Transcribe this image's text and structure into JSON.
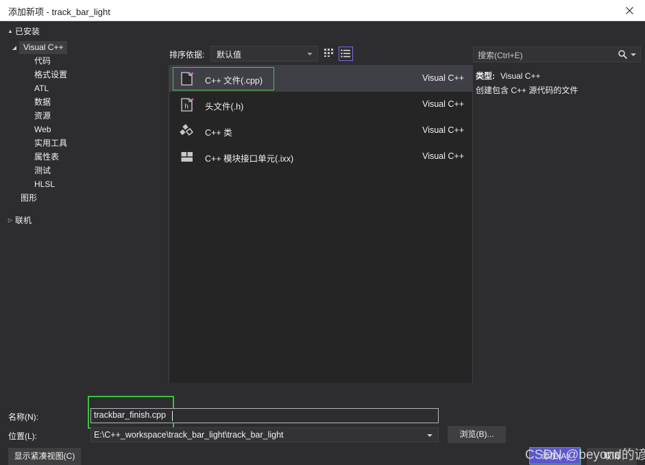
{
  "window": {
    "title": "添加新项 - track_bar_light",
    "close_icon": "close-icon"
  },
  "sidebar": {
    "installed_label": "已安装",
    "installed_twisty": "▲",
    "root_label": "Visual C++",
    "root_twisty": "◢",
    "children": [
      {
        "label": "代码"
      },
      {
        "label": "格式设置"
      },
      {
        "label": "ATL"
      },
      {
        "label": "数据"
      },
      {
        "label": "资源"
      },
      {
        "label": "Web"
      },
      {
        "label": "实用工具"
      },
      {
        "label": "属性表"
      },
      {
        "label": "测试"
      },
      {
        "label": "HLSL"
      }
    ],
    "graphics_label": "图形",
    "online_label": "联机",
    "online_twisty": "▷"
  },
  "toolbar": {
    "sort_label": "排序依据:",
    "sort_value": "默认值",
    "grid_view_icon": "grid-view-icon",
    "list_view_icon": "list-view-icon"
  },
  "search": {
    "placeholder": "搜索(Ctrl+E)",
    "icon": "search-icon"
  },
  "templates": {
    "items": [
      {
        "title": "C++ 文件(.cpp)",
        "origin": "Visual C++",
        "icon": "cpp-file-icon",
        "selected": true
      },
      {
        "title": "头文件(.h)",
        "origin": "Visual C++",
        "icon": "header-file-icon",
        "selected": false
      },
      {
        "title": "C++ 类",
        "origin": "Visual C++",
        "icon": "cpp-class-icon",
        "selected": false
      },
      {
        "title": "C++ 模块接口单元(.ixx)",
        "origin": "Visual C++",
        "icon": "cpp-module-icon",
        "selected": false
      }
    ]
  },
  "detail": {
    "type_label": "类型:",
    "type_value": "Visual C++",
    "description": "创建包含 C++ 源代码的文件"
  },
  "form": {
    "name_label": "名称(N):",
    "name_value": "trackbar_finish.cpp",
    "location_label": "位置(L):",
    "location_value": "E:\\C++_workspace\\track_bar_light\\track_bar_light",
    "browse_label": "浏览(B)..."
  },
  "buttons": {
    "compact_view": "显示紧凑视图(C)",
    "add": "添加(A)",
    "cancel": "取消"
  },
  "watermark": {
    "text": "CSDN @beyond的谚语"
  },
  "colors": {
    "dialog_bg": "#2d2d30",
    "list_bg": "#252526",
    "selected_row": "#3f3f46",
    "focus_green": "#3cc23c",
    "accent_purple": "#5b57c9",
    "titlebar_bg": "#ffffff",
    "text": "#f1f1f1"
  }
}
